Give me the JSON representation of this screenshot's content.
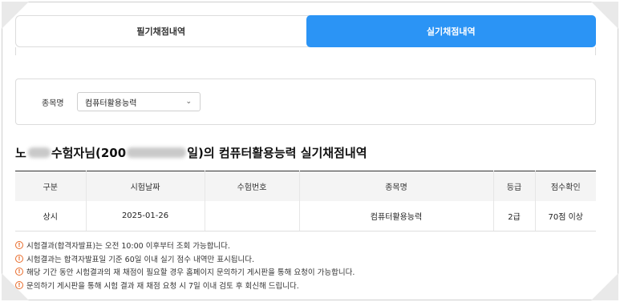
{
  "tabs": [
    {
      "label": "필기채점내역",
      "active": false
    },
    {
      "label": "실기채점내역",
      "active": true
    }
  ],
  "filter": {
    "label": "종목명",
    "selected": "컴퓨터활용능력"
  },
  "heading": {
    "name_prefix": "노",
    "name_suffix": " 수험자님(200",
    "title_suffix": "일)의 컴퓨터활용능력 실기채점내역"
  },
  "table": {
    "headers": [
      "구분",
      "시험날짜",
      "수험번호",
      "종목명",
      "등급",
      "점수확인"
    ],
    "rows": [
      [
        "상시",
        "2025-01-26",
        "",
        "컴퓨터활용능력",
        "2급",
        "70점 이상"
      ]
    ]
  },
  "notes": [
    "시험결과(합격자발표)는 오전 10:00 이후부터 조회 가능합니다.",
    "시험결과는 합격자발표일 기준 60일 이내 실기 점수 내역만 표시됩니다.",
    "해당 기간 동안 시험결과의 재 채점이 필요할 경우 홈페이지 문의하기 게시판을 통해 요청이 가능합니다.",
    "문의하기 게시판을 통해 시험 결과 재 채점 요청 시 7일 이내 검토 후 회신해 드립니다."
  ],
  "colors": {
    "accent": "#2b94f5",
    "note_icon": "#e86b2a"
  }
}
